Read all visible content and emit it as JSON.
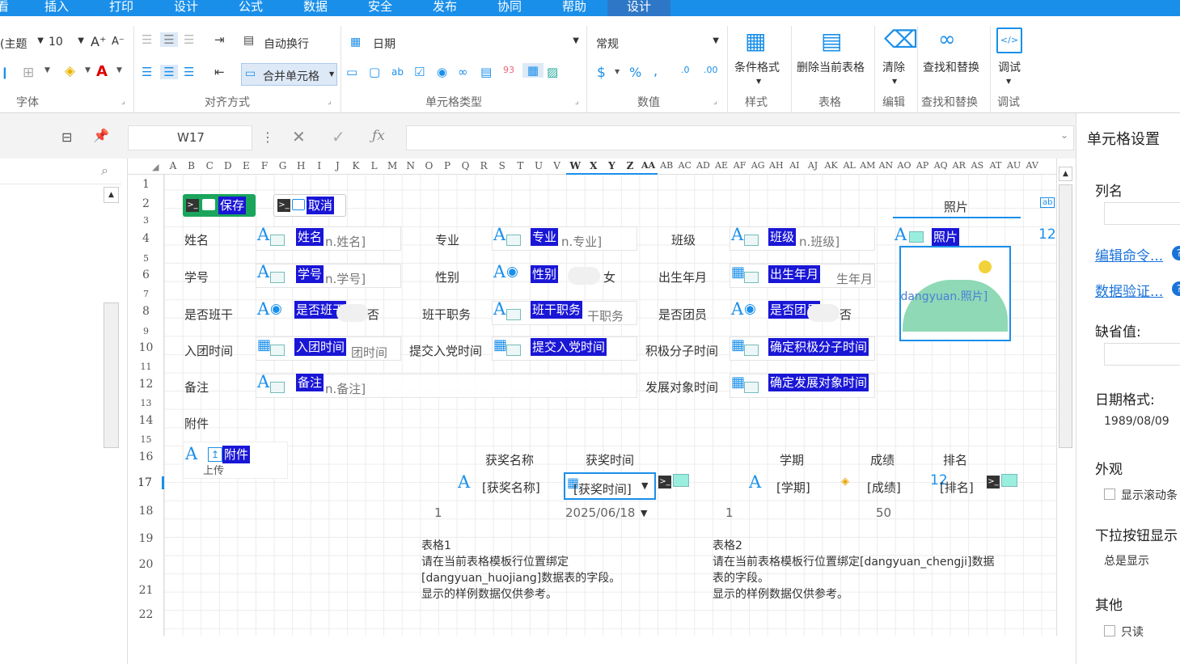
{
  "menu": {
    "items": [
      "插入",
      "打印",
      "设计",
      "公式",
      "数据",
      "安全",
      "发布",
      "协同",
      "帮助",
      "设计"
    ],
    "first_partial": "看"
  },
  "ribbon": {
    "font_name": "(主题",
    "font_size": "10",
    "wrap_text": "自动换行",
    "merge_cells": "合并单元格",
    "cell_type_select": "日期",
    "number_format": "常规",
    "conditional_format": "条件格式",
    "delete_table": "删除当前表格",
    "clear": "清除",
    "find_replace": "查找和替换",
    "debug": "调试",
    "groups": {
      "font": "字体",
      "alignment": "对齐方式",
      "cell_type": "单元格类型",
      "number": "数值",
      "style": "样式",
      "table": "表格",
      "edit": "编辑",
      "find": "查找和替换",
      "debug": "调试"
    }
  },
  "formula_bar": {
    "cell_ref": "W17",
    "fx": "ƒx",
    "formula": ""
  },
  "grid": {
    "columns": [
      "A",
      "B",
      "C",
      "D",
      "E",
      "F",
      "G",
      "H",
      "I",
      "J",
      "K",
      "L",
      "M",
      "N",
      "O",
      "P",
      "Q",
      "R",
      "S",
      "T",
      "U",
      "V",
      "W",
      "X",
      "Y",
      "Z",
      "AA",
      "AB",
      "AC",
      "AD",
      "AE",
      "AF",
      "AG",
      "AH",
      "AI",
      "AJ",
      "AK",
      "AL",
      "AM",
      "AN",
      "AO",
      "AP",
      "AQ",
      "AR",
      "AS",
      "AT",
      "AU",
      "AV"
    ],
    "rows": [
      "1",
      "2",
      "3",
      "4",
      "5",
      "6",
      "7",
      "8",
      "9",
      "10",
      "11",
      "12",
      "13",
      "14",
      "15",
      "16",
      "17",
      "18",
      "19",
      "20",
      "21",
      "22"
    ],
    "buttons": {
      "save": "保存",
      "cancel": "取消"
    },
    "photo_header": "照片",
    "labels": {
      "name": "姓名",
      "major": "专业",
      "class": "班级",
      "student_id": "学号",
      "gender": "性别",
      "birth": "出生年月",
      "is_leader": "是否班干",
      "leader_post": "班干职务",
      "is_member": "是否团员",
      "join_date": "入团时间",
      "submit_date": "提交入党时间",
      "active_date": "积极分子时间",
      "remark": "备注",
      "develop_date": "发展对象时间",
      "attachment": "附件"
    },
    "tags": {
      "name": "姓名",
      "major": "专业",
      "class": "班级",
      "photo": "照片",
      "student_id": "学号",
      "gender": "性别",
      "birth": "出生年月",
      "is_leader": "是否班干",
      "leader_post": "班干职务",
      "is_member": "是否团员",
      "join_date": "入团时间",
      "submit_date": "提交入党时间",
      "active_date": "确定积极分子时间",
      "remark": "备注",
      "develop_date": "确定发展对象时间",
      "attachment": "附件"
    },
    "placeholders": {
      "name": "n.姓名]",
      "major": "n.专业]",
      "class": "n.班级]",
      "student_id": "n.学号]",
      "birth": "生年月",
      "leader_post": "干职务",
      "join_date": "团时间",
      "remark": "n.备注]",
      "photo": "[dangyuan.照片]",
      "upload": "上传"
    },
    "gender_female": "女",
    "no_leader": "否",
    "no_member": "否",
    "sub1": {
      "headers": [
        "获奖名称",
        "获奖时间"
      ],
      "template": [
        "[获奖名称]",
        "[获奖时间]"
      ],
      "sample": [
        "1",
        "2025/06/18"
      ],
      "note_title": "表格1",
      "note_lines": [
        "请在当前表格模板行位置绑定",
        "[dangyuan_huojiang]数据表的字段。",
        "显示的样例数据仅供参考。"
      ]
    },
    "sub2": {
      "headers": [
        "学期",
        "成绩",
        "排名"
      ],
      "template": [
        "[学期]",
        "[成绩]",
        "[排名]"
      ],
      "sample": [
        "1",
        "50"
      ],
      "note_title": "表格2",
      "note_lines": [
        "请在当前表格模板行位置绑定[dangyuan_chengji]数据",
        "表的字段。",
        "显示的样例数据仅供参考。"
      ]
    }
  },
  "right_panel": {
    "title": "单元格设置",
    "column_name": "列名",
    "edit_command": "编辑命令...",
    "data_validation": "数据验证...",
    "default_value": "缺省值:",
    "date_format": "日期格式:",
    "date_format_value": "1989/08/09",
    "appearance": "外观",
    "show_scroll": "显示滚动条",
    "dropdown_show": "下拉按钮显示",
    "dropdown_value": "总是显示",
    "other": "其他",
    "readonly": "只读"
  }
}
